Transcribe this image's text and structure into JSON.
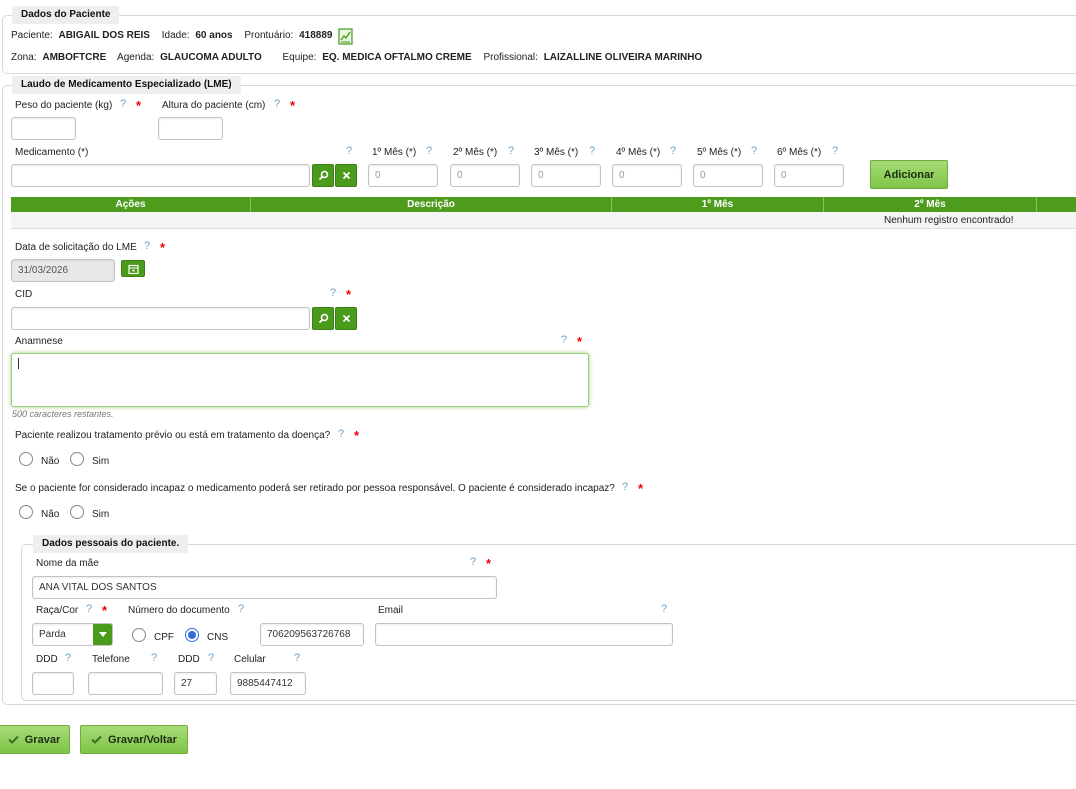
{
  "patient_section": {
    "legend": "Dados do Paciente",
    "paciente_label": "Paciente:",
    "paciente_value": "ABIGAIL DOS REIS",
    "idade_label": "Idade:",
    "idade_value": "60 anos",
    "prontuario_label": "Prontuário:",
    "prontuario_value": "418889",
    "zona_label": "Zona:",
    "zona_value": "AMBOFTCRE",
    "agenda_label": "Agenda:",
    "agenda_value": "GLAUCOMA ADULTO",
    "equipe_label": "Equipe:",
    "equipe_value": "EQ. MEDICA OFTALMO CREME",
    "profissional_label": "Profissional:",
    "profissional_value": "LAIZALLINE OLIVEIRA MARINHO",
    "chart_icon": "chart-report-icon"
  },
  "lme": {
    "legend": "Laudo de Medicamento Especializado (LME)",
    "peso_label": "Peso do paciente (kg)",
    "altura_label": "Altura do paciente (cm)",
    "medicamento_label": "Medicamento (*)",
    "months": [
      {
        "label": "1º Mês (*)",
        "placeholder": "0"
      },
      {
        "label": "2º Mês (*)",
        "placeholder": "0"
      },
      {
        "label": "3º Mês (*)",
        "placeholder": "0"
      },
      {
        "label": "4º Mês (*)",
        "placeholder": "0"
      },
      {
        "label": "5º Mês (*)",
        "placeholder": "0"
      },
      {
        "label": "6º Mês (*)",
        "placeholder": "0"
      }
    ],
    "add_button": "Adicionar",
    "table": {
      "headers": [
        "Ações",
        "Descrição",
        "1º Mês",
        "2º Mês"
      ],
      "empty": "Nenhum registro encontrado!"
    },
    "data_label": "Data de solicitação do LME",
    "data_value": "31/03/2026",
    "cid_label": "CID",
    "anamnese_label": "Anamnese",
    "anamnese_value": "",
    "remaining": "500 caracteres restantes.",
    "q_tratamento": "Paciente realizou tratamento prévio ou está em tratamento da doença?",
    "q_incapaz": "Se o paciente for considerado incapaz o medicamento poderá ser retirado por pessoa responsável. O paciente é considerado incapaz?",
    "opt_nao": "Não",
    "opt_sim": "Sim"
  },
  "personal": {
    "legend": "Dados pessoais do paciente.",
    "mae_label": "Nome da mãe",
    "mae_value": "ANA VITAL DOS SANTOS",
    "raca_label": "Raça/Cor",
    "raca_value": "Parda",
    "doc_label": "Número do documento",
    "doc_cpf": "CPF",
    "doc_cns": "CNS",
    "doc_value": "706209563726768",
    "email_label": "Email",
    "ddd_label": "DDD",
    "telefone_label": "Telefone",
    "ddd2_label": "DDD",
    "ddd2_value": "27",
    "celular_label": "Celular",
    "celular_value": "9885447412"
  },
  "actions": {
    "gravar": "Gravar",
    "gravar_voltar": "Gravar/Voltar"
  },
  "help_glyph": "?",
  "required_glyph": "*"
}
